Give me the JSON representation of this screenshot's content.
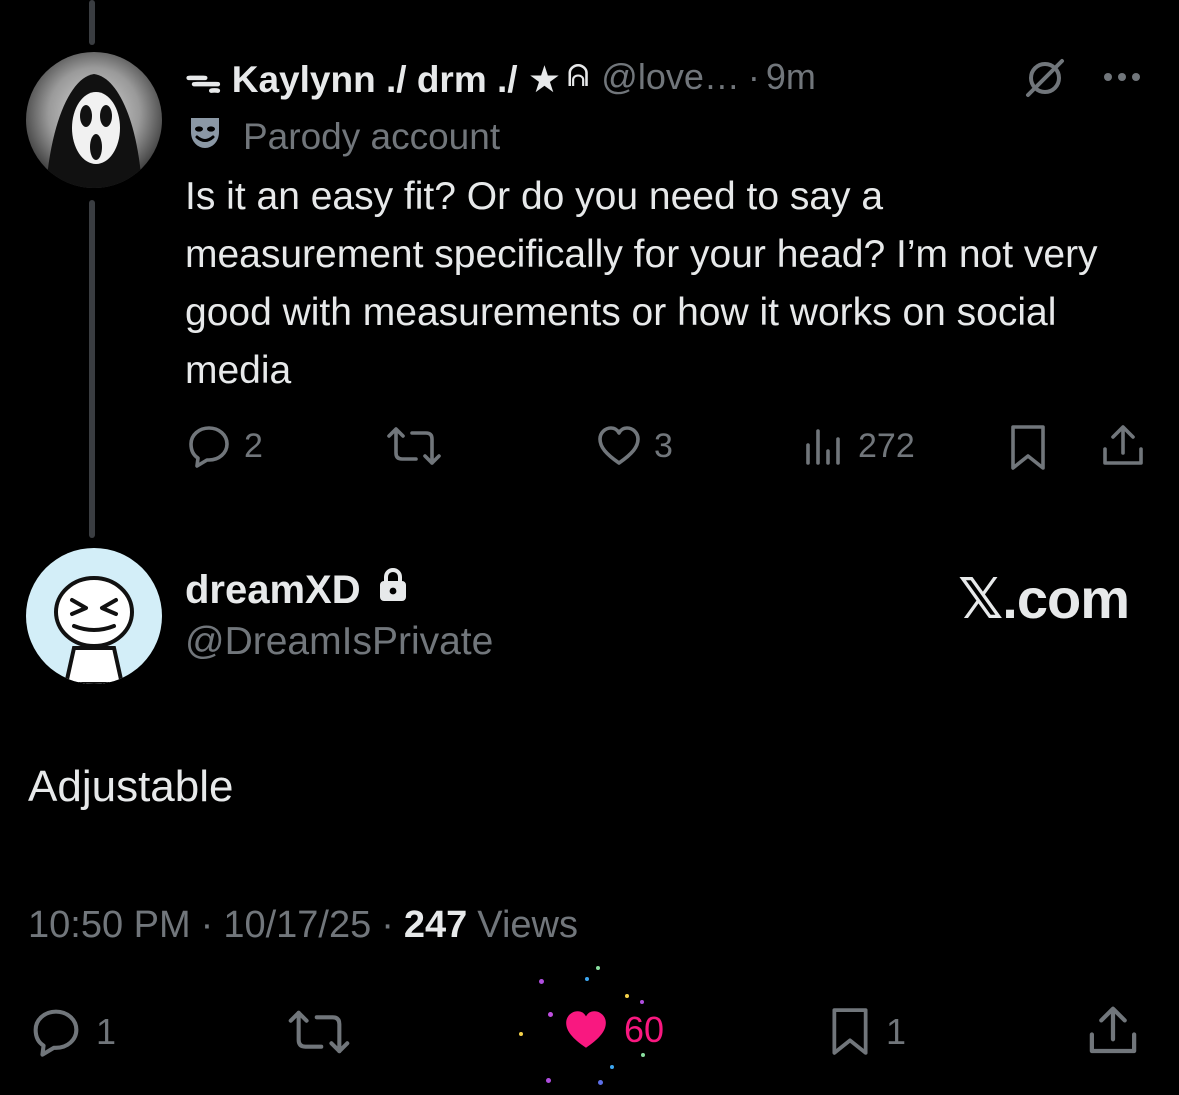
{
  "parent_post": {
    "display_name": "ᯓ Kaylynn ./ drm ./ ★",
    "name_suffix_glyph": "ᕱ",
    "handle": "@love…",
    "time_sep": "·",
    "time": "9m",
    "badge_icon": "masks-icon",
    "badge_label": "Parody account",
    "text": "Is it an easy fit? Or do you need to say a measurement specifically for your head? I’m not very good with measurements or how it works on social media",
    "replies": "2",
    "likes": "3",
    "views": "272"
  },
  "reply_post": {
    "display_name": "dreamXD",
    "lock_icon": "lock-icon",
    "handle": "@DreamIsPrivate",
    "brand": "𝕏.com",
    "text": "Adjustable",
    "time": "10:50 PM",
    "sep1": "·",
    "date": "10/17/25",
    "sep2": "·",
    "views_count": "247",
    "views_label": "Views",
    "replies": "1",
    "likes": "60",
    "bookmarks": "1"
  },
  "colors": {
    "background": "#000000",
    "text": "#e7e9ea",
    "muted": "#71767b",
    "like_pink": "#f91880",
    "thread_line": "#3a3d41"
  }
}
